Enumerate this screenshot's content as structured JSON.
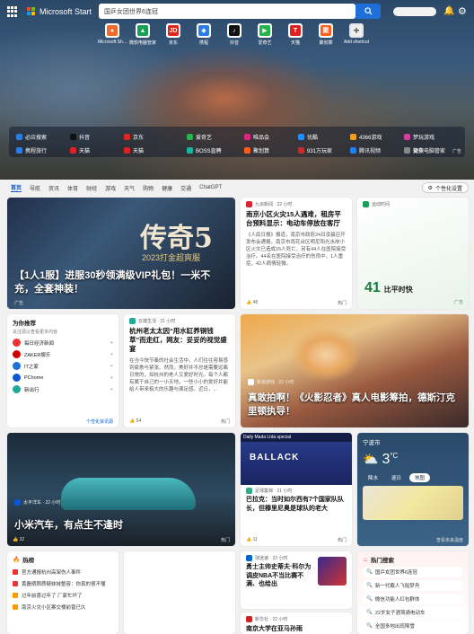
{
  "header": {
    "brand": "Microsoft Start",
    "search_placeholder": "国乒女团世界6连冠"
  },
  "shortcuts": [
    {
      "label": "Microsoft Sh...",
      "glyph": "●",
      "color": "#f06a2a"
    },
    {
      "label": "微软电脑管家",
      "glyph": "▲",
      "color": "#18a058"
    },
    {
      "label": "京东",
      "glyph": "JD",
      "color": "#e1251b"
    },
    {
      "label": "携程",
      "glyph": "◆",
      "color": "#2d7be5"
    },
    {
      "label": "抖音",
      "glyph": "♪",
      "color": "#111111"
    },
    {
      "label": "爱奇艺",
      "glyph": "▶",
      "color": "#25b34b"
    },
    {
      "label": "天猫",
      "glyph": "T",
      "color": "#e02020"
    },
    {
      "label": "聚划算",
      "glyph": "聚",
      "color": "#ff5e1a"
    },
    {
      "label": "Add shortcut",
      "glyph": "+",
      "color": "#eeeeee"
    }
  ],
  "quick_links": [
    {
      "label": "必应搜索",
      "color": "#2a7de1"
    },
    {
      "label": "抖音",
      "color": "#111111"
    },
    {
      "label": "京东",
      "color": "#e1251b"
    },
    {
      "label": "爱奇艺",
      "color": "#25b34b"
    },
    {
      "label": "唯品会",
      "color": "#e0237a"
    },
    {
      "label": "优酷",
      "color": "#1e90ff"
    },
    {
      "label": "4366游戏",
      "color": "#f0a020"
    },
    {
      "label": "梦玩游戏",
      "color": "#d040a0"
    },
    {
      "label": "携程旅行",
      "color": "#2d7be5"
    },
    {
      "label": "天猫",
      "color": "#e02020"
    },
    {
      "label": "天猫",
      "color": "#e02020"
    },
    {
      "label": "BOSS直聘",
      "color": "#19b3a0"
    },
    {
      "label": "聚划算",
      "color": "#ff5e1a"
    },
    {
      "label": "931万玩家",
      "color": "#c03030"
    },
    {
      "label": "腾讯视频",
      "color": "#2080f0"
    },
    {
      "label": "微软电脑管家",
      "color": "#18a058"
    },
    {
      "label": "更多",
      "color": "#888888"
    }
  ],
  "ad_label": "广告",
  "nav": {
    "tabs": [
      "首页",
      "导航",
      "资讯",
      "体育",
      "财经",
      "游戏",
      "天气",
      "购物",
      "健康",
      "交通",
      "ChatGPT"
    ],
    "personal": "个性化设置"
  },
  "cards": {
    "game_ad": {
      "art_title": "传奇5",
      "art_subtitle": "2023打金超爽服",
      "title": "【1人1服】进服30秒领满级VIP礼包！一米不充，全套神装！",
      "ad": "广告"
    },
    "nanjing": {
      "source": "九派新闻",
      "time": "22 小时",
      "title": "南京小区火灾15人遇难，租房平台预料显示：电动车停放在客厅",
      "body": "《人民日报》报道，南京市政府24日凌晨召开发布会通报，南京市雨花台区明尼阳光水岸小区火灾已造成15人死亡，另有44人在医院接受治疗。44名在医院接受治疗的伤员中，1人重症，42人病情轻微。",
      "likes": "48",
      "hot": "热门"
    },
    "sports": {
      "source": "运动时间",
      "score": "41",
      "score_label": "比平时快",
      "ad": "广告"
    },
    "recommend": {
      "title": "为你推荐",
      "subtitle": "关注源以查看更多内容",
      "items": [
        "每日经济新闻",
        "ZAKER娱乐",
        "IT之家",
        "PChome",
        "新出行"
      ],
      "more": "个性化资讯源"
    },
    "hangzhou": {
      "source": "云端生活",
      "time": "21 小时",
      "title": "杭州老太太因“用水缸养铜钱草”而走红，网友：妥妥的视觉盛宴",
      "body": "在当今快节奏的社会生活中，人们往往容易感到疲惫与紧张。然而，美好并不总是需要远离日常的，如杭州的老人又爱好时光。每个人都有属于自己的一小天地，一些小小的爱好并能给人带来极大的乐趣与满足感。近日，...",
      "likes": "54",
      "hot": "热门"
    },
    "naruto": {
      "source": "新浪游戏",
      "time": "22 小时",
      "title": "真敢拍啊！《火影忍者》真人电影筹拍，德斯汀克里顿执导！"
    },
    "car": {
      "source": "太平洋车",
      "time": "22 小时",
      "title": "小米汽车，有点生不逢时",
      "likes": "32",
      "hot": "热门"
    },
    "football": {
      "banner": "Daily Mada Ltda special",
      "jersey": "BALLACK",
      "source": "足球集锦",
      "time": "21 小时",
      "title": "巴拉克：当时如尔西有7个国家队队长，但穆里尼奥是球队的老大",
      "likes": "11",
      "hot": "热门"
    },
    "weather": {
      "city": "宁波市",
      "temp": "3",
      "unit": "°C",
      "tabs": [
        "降水",
        "逐日",
        "地图"
      ],
      "cta": "查看未来温度"
    },
    "hotlist": {
      "title": "热榜",
      "items": [
        "官方通报杭州高架伤人事件",
        "黄磊晒照质疑妹妹整容：你真的很不懂",
        "过年前喜过年了 厂家忙坏了",
        "南京火灾小区案交楼前曾已久"
      ]
    },
    "warriors": {
      "source": "球迷速",
      "time": "22 小时",
      "title": "勇士主帅史蒂夫·科尔为调皮NBA不当比赛不满、也给出"
    },
    "china_island": {
      "source": "新华社",
      "time": "22 小时",
      "title": "南京大学在亚马孙雨"
    },
    "hotsearch": {
      "title": "热门搜索",
      "items": [
        "国乒女团世界6连冠",
        "新一代载人飞船梦舟",
        "微信功能人红包群体",
        "22岁女子酒驾骑电动车",
        "全国多地出现降雪"
      ]
    }
  }
}
